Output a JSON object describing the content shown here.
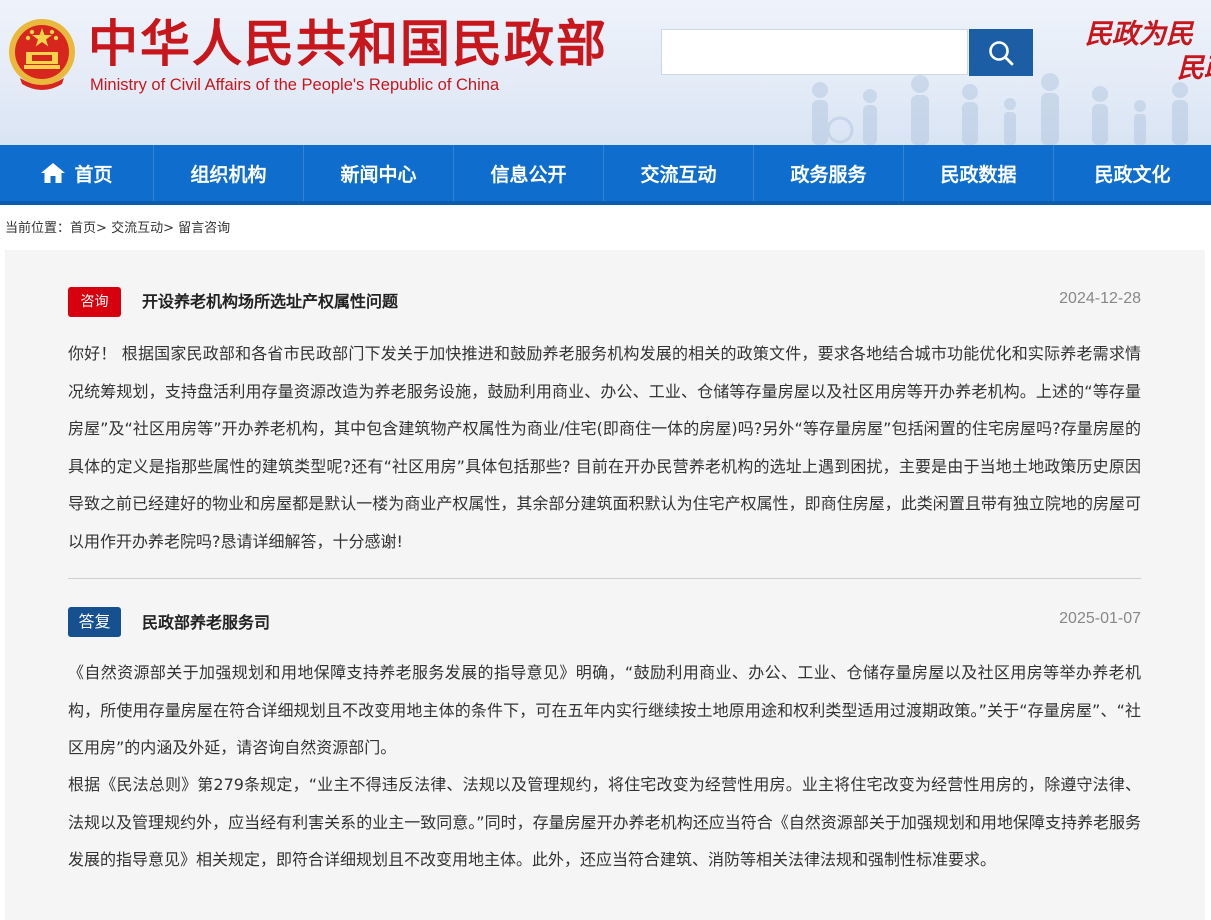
{
  "header": {
    "title_cn": "中华人民共和国民政部",
    "title_en": "Ministry of Civil Affairs of the People's Republic of China",
    "search": {
      "placeholder": "",
      "value": ""
    },
    "slogan": [
      "民政为民",
      "民政爱民"
    ]
  },
  "nav": [
    {
      "label": "首页",
      "icon": "home-icon"
    },
    {
      "label": "组织机构"
    },
    {
      "label": "新闻中心"
    },
    {
      "label": "信息公开"
    },
    {
      "label": "交流互动"
    },
    {
      "label": "政务服务"
    },
    {
      "label": "民政数据"
    },
    {
      "label": "民政文化"
    }
  ],
  "breadcrumb": {
    "prefix": "当前位置：",
    "items": [
      "首页",
      "交流互动",
      "留言咨询"
    ],
    "separator": ">"
  },
  "question": {
    "badge": "咨询",
    "title": "开设养老机构场所选址产权属性问题",
    "date": "2024-12-28",
    "body": "你好！ 根据国家民政部和各省市民政部门下发关于加快推进和鼓励养老服务机构发展的相关的政策文件，要求各地结合城市功能优化和实际养老需求情况统筹规划，支持盘活利用存量资源改造为养老服务设施，鼓励利用商业、办公、工业、仓储等存量房屋以及社区用房等开办养老机构。上述的“等存量房屋”及“社区用房等”开办养老机构，其中包含建筑物产权属性为商业/住宅(即商住一体的房屋)吗?另外“等存量房屋”包括闲置的住宅房屋吗?存量房屋的具体的定义是指那些属性的建筑类型呢?还有“社区用房”具体包括那些? 目前在开办民营养老机构的选址上遇到困扰，主要是由于当地土地政策历史原因导致之前已经建好的物业和房屋都是默认一楼为商业产权属性，其余部分建筑面积默认为住宅产权属性，即商住房屋，此类闲置且带有独立院地的房屋可以用作开办养老院吗?恳请详细解答，十分感谢!"
  },
  "answer": {
    "badge": "答复",
    "title": "民政部养老服务司",
    "date": "2025-01-07",
    "body": [
      "《自然资源部关于加强规划和用地保障支持养老服务发展的指导意见》明确，“鼓励利用商业、办公、工业、仓储存量房屋以及社区用房等举办养老机构，所使用存量房屋在符合详细规划且不改变用地主体的条件下，可在五年内实行继续按土地原用途和权利类型适用过渡期政策。”关于“存量房屋”、“社区用房”的内涵及外延，请咨询自然资源部门。",
      "根据《民法总则》第279条规定，“业主不得违反法律、法规以及管理规约，将住宅改变为经营性用房。业主将住宅改变为经营性用房的，除遵守法律、法规以及管理规约外，应当经有利害关系的业主一致同意。”同时，存量房屋开办养老机构还应当符合《自然资源部关于加强规划和用地保障支持养老服务发展的指导意见》相关规定，即符合详细规划且不改变用地主体。此外，还应当符合建筑、消防等相关法律法规和强制性标准要求。"
    ]
  },
  "colors": {
    "brand_red": "#c8161d",
    "nav_blue": "#0f6ecd",
    "search_blue": "#1c5ea6",
    "question_badge": "#d7000f",
    "answer_badge": "#17508f",
    "content_bg": "#f5f5f5"
  }
}
